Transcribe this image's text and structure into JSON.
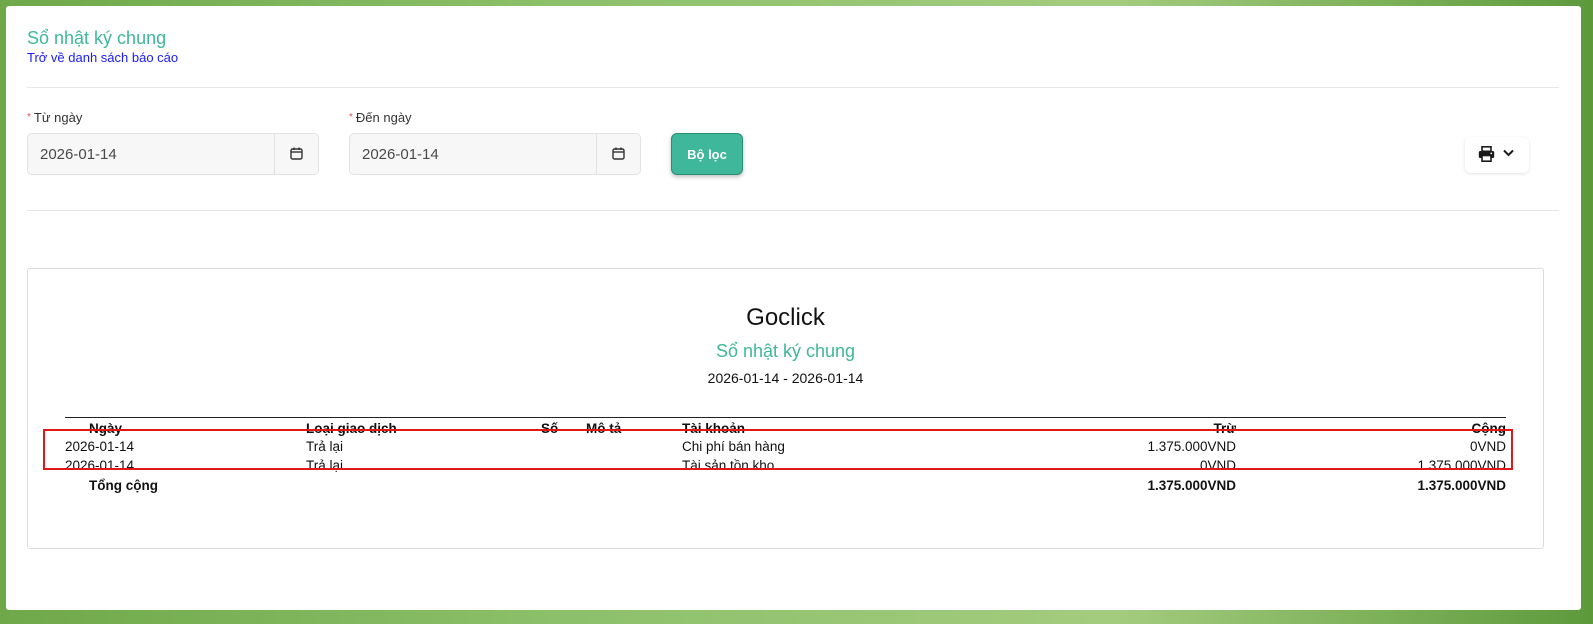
{
  "header": {
    "title": "Sổ nhật ký chung",
    "back_link": "Trở về danh sách báo cáo"
  },
  "filters": {
    "from_label": "Từ ngày",
    "from_value": "2026-01-14",
    "to_label": "Đến ngày",
    "to_value": "2026-01-14",
    "required_mark": "*",
    "filter_button": "Bộ lọc"
  },
  "report": {
    "company": "Goclick",
    "title": "Sổ nhật ký chung",
    "range": "2026-01-14 - 2026-01-14",
    "columns": {
      "date": "Ngày",
      "type": "Loại giao dịch",
      "number": "Số",
      "description": "Mô tả",
      "account": "Tài khoản",
      "debit": "Trừ",
      "credit": "Cộng"
    },
    "rows": [
      {
        "date": "2026-01-14",
        "type": "Trả lại",
        "number": "",
        "description": "",
        "account": "Chi phí bán hàng",
        "debit": "1.375.000VND",
        "credit": "0VND"
      },
      {
        "date": "2026-01-14",
        "type": "Trả lại",
        "number": "",
        "description": "",
        "account": "Tài sản tồn kho",
        "debit": "0VND",
        "credit": "1.375.000VND"
      }
    ],
    "total": {
      "label": "Tổng cộng",
      "debit": "1.375.000VND",
      "credit": "1.375.000VND"
    }
  },
  "icons": {
    "calendar": "calendar-icon",
    "print": "printer-icon",
    "dropdown": "chevron-down-icon"
  },
  "colors": {
    "accent": "#3fb79a",
    "link": "#1a1aff",
    "highlight": "#e01818"
  }
}
